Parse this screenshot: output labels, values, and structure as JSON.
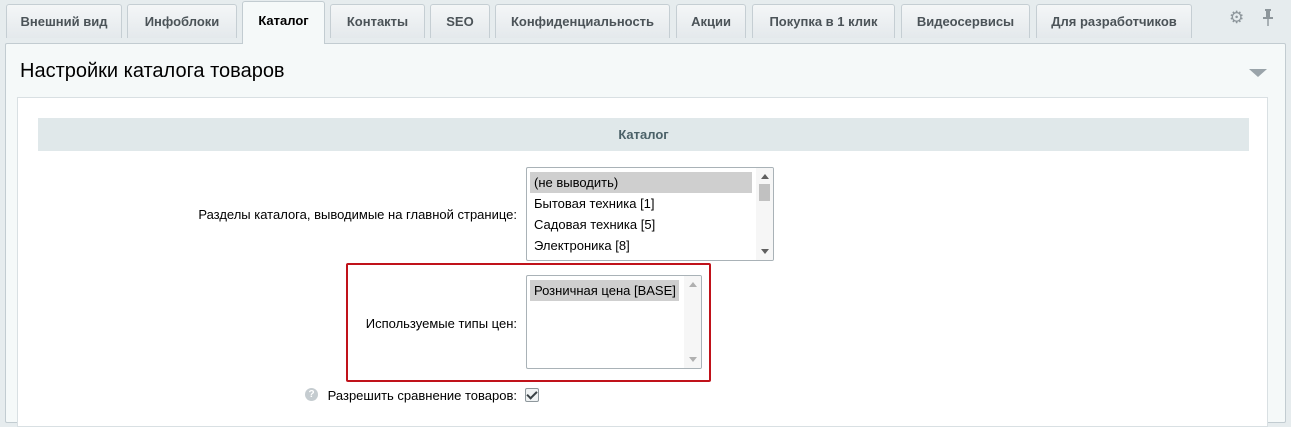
{
  "tabs": [
    {
      "label": "Внешний вид"
    },
    {
      "label": "Инфоблоки"
    },
    {
      "label": "Каталог",
      "active": true
    },
    {
      "label": "Контакты"
    },
    {
      "label": "SEO"
    },
    {
      "label": "Конфиденциальность"
    },
    {
      "label": "Акции"
    },
    {
      "label": "Покупка в 1 клик"
    },
    {
      "label": "Видеосервисы"
    },
    {
      "label": "Для разработчиков"
    }
  ],
  "toolbar": {
    "icons": [
      "gear-icon",
      "pin-icon"
    ]
  },
  "section": {
    "title": "Настройки каталога товаров"
  },
  "group": {
    "title": "Каталог"
  },
  "fields": {
    "sections": {
      "label": "Разделы каталога, выводимые на главной странице:",
      "options": [
        {
          "text": "(не выводить)",
          "selected": true
        },
        {
          "text": "Бытовая техника [1]",
          "selected": false
        },
        {
          "text": "Садовая техника [5]",
          "selected": false
        },
        {
          "text": "Электроника [8]",
          "selected": false
        }
      ]
    },
    "price_types": {
      "label": "Используемые типы цен:",
      "options": [
        {
          "text": "Розничная цена [BASE]",
          "selected": true
        }
      ]
    },
    "compare": {
      "label": "Разрешить сравнение товаров:",
      "checked": true,
      "help_icon": "?"
    }
  },
  "colors": {
    "highlight": "#c0121a",
    "group_header_bg": "#e0e8ea"
  }
}
